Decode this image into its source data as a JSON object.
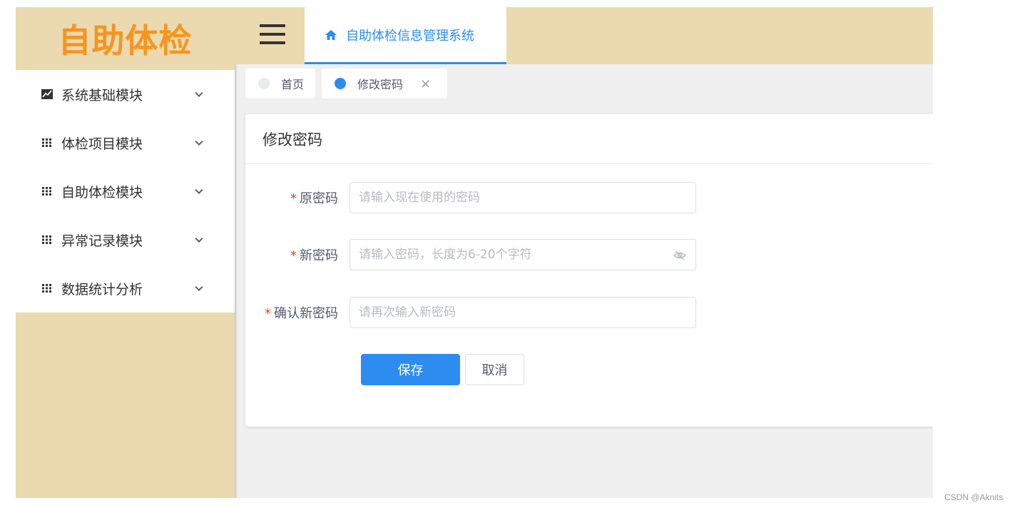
{
  "logo": {
    "text": "自助体检",
    "color": "#f5961f"
  },
  "sidebar": {
    "bg_color": "#ebd9b0",
    "items": [
      {
        "label": "系统基础模块",
        "icon": "chart-icon"
      },
      {
        "label": "体检项目模块",
        "icon": "grid-icon"
      },
      {
        "label": "自助体检模块",
        "icon": "grid-icon"
      },
      {
        "label": "异常记录模块",
        "icon": "grid-icon"
      },
      {
        "label": "数据统计分析",
        "icon": "grid-icon"
      }
    ]
  },
  "header": {
    "menu_icon": "hamburger-icon",
    "tab": {
      "label": "自助体检信息管理系统",
      "icon": "home-icon"
    },
    "accent_color": "#2d8cf0"
  },
  "tags": [
    {
      "label": "首页",
      "active": false
    },
    {
      "label": "修改密码",
      "active": true,
      "closable": true,
      "close_symbol": "×"
    }
  ],
  "form": {
    "title": "修改密码",
    "required_mark": "*",
    "fields": [
      {
        "label": "原密码",
        "placeholder": "请输入现在使用的密码",
        "value": ""
      },
      {
        "label": "新密码",
        "placeholder": "请输入密码，长度为6-20个字符",
        "value": "",
        "icon": "eye-off-icon"
      },
      {
        "label": "确认新密码",
        "placeholder": "请再次输入新密码",
        "value": ""
      }
    ],
    "save_label": "保存",
    "cancel_label": "取消"
  },
  "watermark": "CSDN @Aknits"
}
